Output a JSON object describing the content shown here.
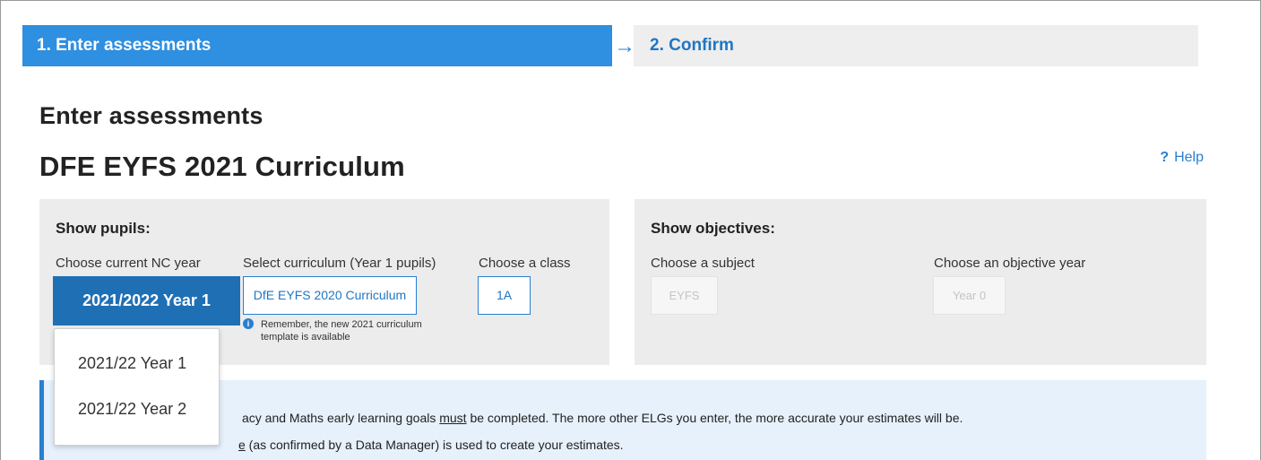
{
  "steps": {
    "step1": "1. Enter assessments",
    "arrow": "→",
    "step2": "2. Confirm"
  },
  "page": {
    "title": "Enter assessments",
    "curriculum_title": "DFE EYFS 2021 Curriculum",
    "help_icon": "?",
    "help_label": "Help"
  },
  "pupils": {
    "title": "Show pupils:",
    "year_label": "Choose current NC year",
    "year_value": "2021/2022 Year 1",
    "curriculum_label": "Select curriculum (Year 1 pupils)",
    "curriculum_value": "DfE EYFS 2020 Curriculum",
    "class_label": "Choose a class",
    "class_value": "1A",
    "note_icon": "i",
    "note_line1": "Remember, the new 2021 curriculum",
    "note_line2": "template is available"
  },
  "objectives": {
    "title": "Show objectives:",
    "subject_label": "Choose a subject",
    "subject_value": "EYFS",
    "year_label": "Choose an objective year",
    "year_value": "Year 0"
  },
  "dropdown": {
    "options": [
      "2021/22 Year 1",
      "2021/22 Year 2"
    ]
  },
  "info": {
    "line1_start": "acy and Maths early learning goals ",
    "line1_must": "must",
    "line1_end": " be completed. The more other ELGs you enter, the more accurate your estimates will be.",
    "line2_underlined": "e",
    "line2_end": " (as confirmed by a Data Manager) is used to create your estimates."
  },
  "colors": {
    "accent": "#2f8fe0",
    "selected_button": "#1f6fb5",
    "panel_bg": "#ececec",
    "info_bg": "#e6f1fb"
  }
}
